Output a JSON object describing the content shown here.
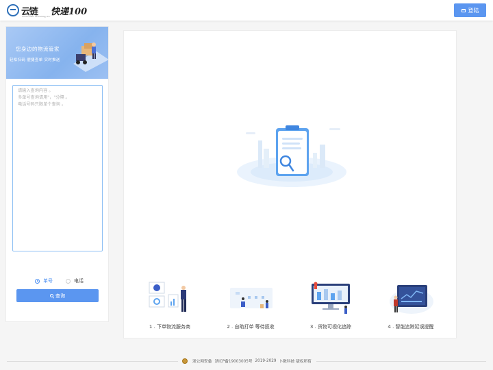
{
  "header": {
    "logo_yunlian": "云链",
    "logo_yunlian_sub": "Cloud Chain Technology Co.",
    "logo_kuaidi": "快递100",
    "login_label": "登陆"
  },
  "left_panel": {
    "banner_title": "您身边的物流管家",
    "banner_subtitle": "轻松扫码  便捷查单  实时推送",
    "textarea_placeholder": "请输入查询内容 。\n多单号查询请用\"，\"分隔 。\n电话号码只限单个查询 。",
    "textarea_value": "",
    "radio_options": [
      {
        "label": "单号",
        "checked": true
      },
      {
        "label": "电话",
        "checked": false
      }
    ],
    "search_label": "查询"
  },
  "steps": [
    {
      "label": "1 . 下单物流服务商"
    },
    {
      "label": "2 . 自助打单 等待揽收"
    },
    {
      "label": "3 . 货物可视化追踪"
    },
    {
      "label": "4 . 智能追踪延误提醒"
    }
  ],
  "footer": {
    "gongan": "浙公网安备",
    "icp": "浙ICP备19003005号",
    "years": "2019-2029",
    "copyright": "卜数科技 版权所有"
  },
  "colors": {
    "accent": "#5b96f0",
    "textarea_border": "#8ec0f4",
    "banner": "#9cc0f2"
  }
}
